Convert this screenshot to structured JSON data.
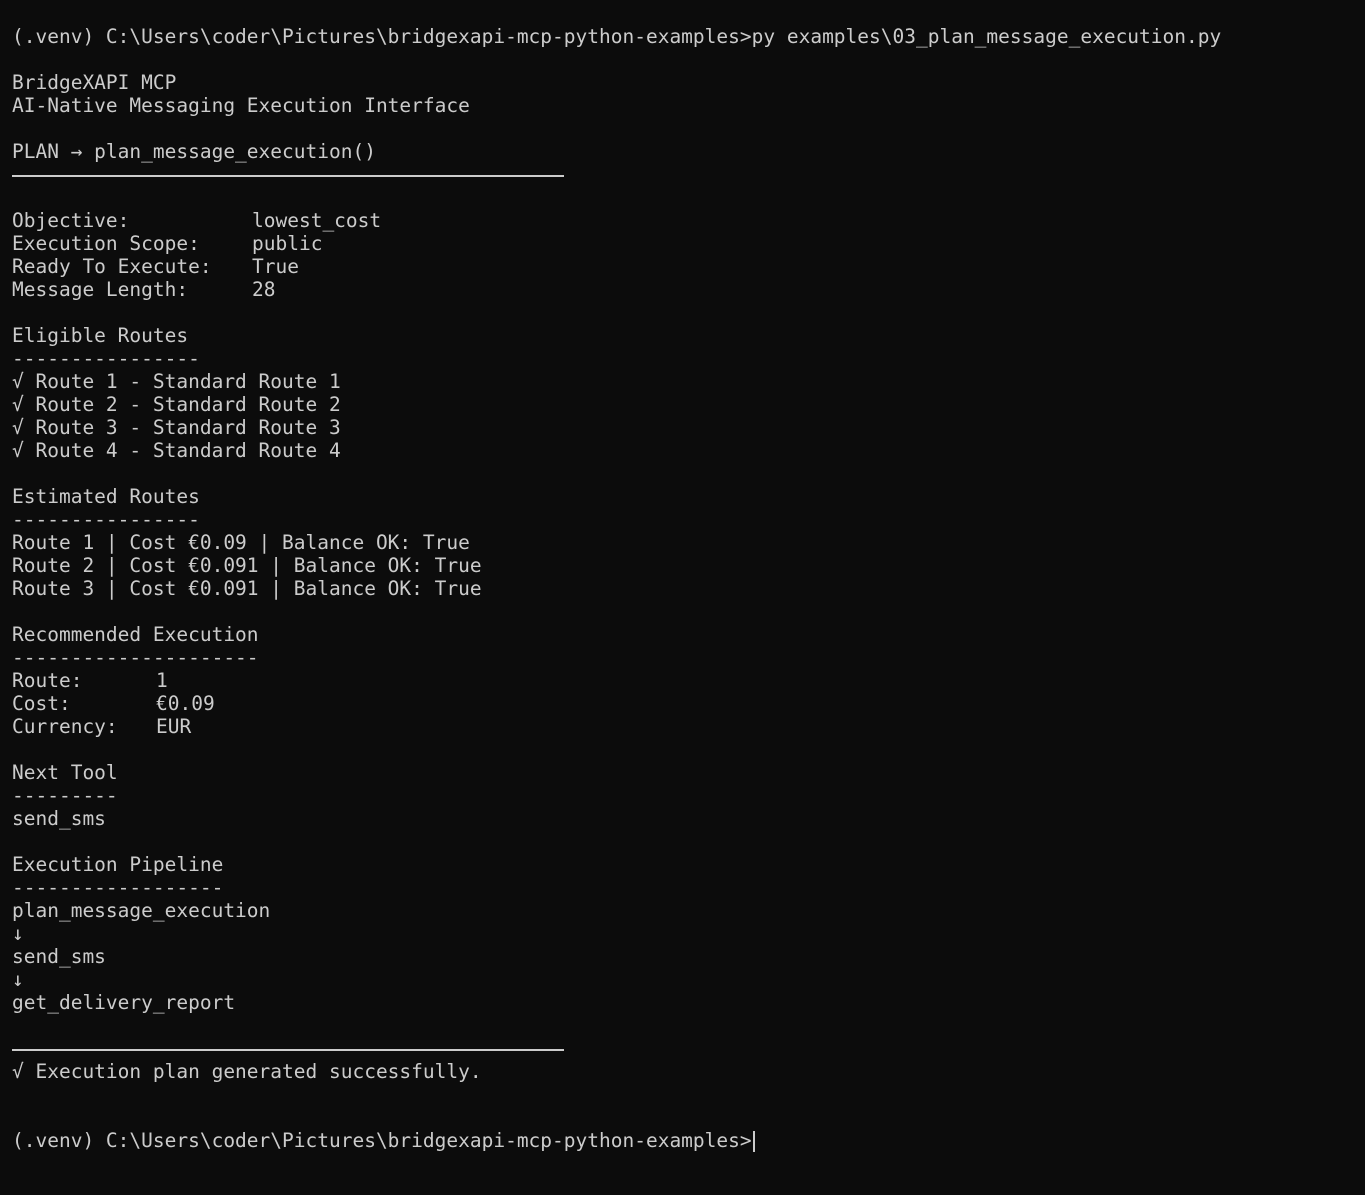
{
  "command": {
    "prompt": "(.venv) C:\\Users\\coder\\Pictures\\bridgexapi-mcp-python-examples>",
    "input": "py examples\\03_plan_message_execution.py"
  },
  "banner": {
    "title": "BridgeXAPI MCP",
    "subtitle": "AI-Native Messaging Execution Interface"
  },
  "plan_header": "PLAN → plan_message_execution()",
  "summary": [
    {
      "key": "Objective:",
      "value": "lowest_cost"
    },
    {
      "key": "Execution Scope:",
      "value": "public"
    },
    {
      "key": "Ready To Execute:",
      "value": "True"
    },
    {
      "key": "Message Length:",
      "value": "28"
    }
  ],
  "eligible": {
    "title": "Eligible Routes",
    "underline": "----------------",
    "items": [
      "√ Route 1 - Standard Route 1",
      "√ Route 2 - Standard Route 2",
      "√ Route 3 - Standard Route 3",
      "√ Route 4 - Standard Route 4"
    ]
  },
  "estimated": {
    "title": "Estimated Routes",
    "underline": "----------------",
    "items": [
      "Route 1 | Cost €0.09 | Balance OK: True",
      "Route 2 | Cost €0.091 | Balance OK: True",
      "Route 3 | Cost €0.091 | Balance OK: True"
    ]
  },
  "recommended": {
    "title": "Recommended Execution",
    "underline": "---------------------",
    "rows": [
      {
        "key": "Route:",
        "value": "1"
      },
      {
        "key": "Cost:",
        "value": "€0.09"
      },
      {
        "key": "Currency:",
        "value": "EUR"
      }
    ]
  },
  "next_tool": {
    "title": "Next Tool",
    "underline": "---------",
    "value": "send_sms"
  },
  "pipeline": {
    "title": "Execution Pipeline",
    "underline": "------------------",
    "steps": [
      "plan_message_execution",
      "↓",
      "send_sms",
      "↓",
      "get_delivery_report"
    ]
  },
  "success": "√ Execution plan generated successfully.",
  "final_prompt": "(.venv) C:\\Users\\coder\\Pictures\\bridgexapi-mcp-python-examples>"
}
